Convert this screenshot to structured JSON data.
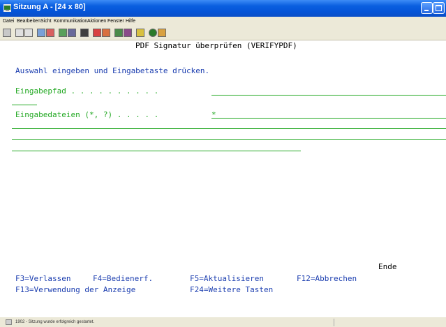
{
  "window": {
    "title": "Sitzung A - [24 x 80]"
  },
  "menu": [
    "Datei",
    "Bearbeiten",
    "Sicht",
    "Kommunikation",
    "Aktionen",
    "Fenster",
    "Hilfe"
  ],
  "toolbar_icons": [
    "print-icon",
    "copy-icon",
    "paste-icon",
    "send-icon",
    "receive-icon",
    "display-icon",
    "keyboard-icon",
    "macro-icon",
    "record-icon",
    "play-icon",
    "color-icon",
    "settings-icon",
    "help-icon",
    "globe-icon",
    "pen-icon"
  ],
  "screen": {
    "title": "PDF Signatur überprüfen (VERIFYPDF)",
    "instruction": "Auswahl eingeben und Eingabetaste drücken.",
    "field1_label": "Eingabepfad . . . . . . . . . .",
    "field1_value": "_",
    "field2_label": "Eingabedateien (*, ?) . . . . .",
    "field2_value": "*",
    "end_label": "Ende",
    "fkeys": {
      "f3": "F3=Verlassen",
      "f4": "F4=Bedienerf.",
      "f5": "F5=Aktualisieren",
      "f12": "F12=Abbrechen",
      "f13": "F13=Verwendung der Anzeige",
      "f24": "F24=Weitere Tasten"
    }
  },
  "status": {
    "message": "1902 - Sitzung wurde erfolgreich gestartet."
  }
}
